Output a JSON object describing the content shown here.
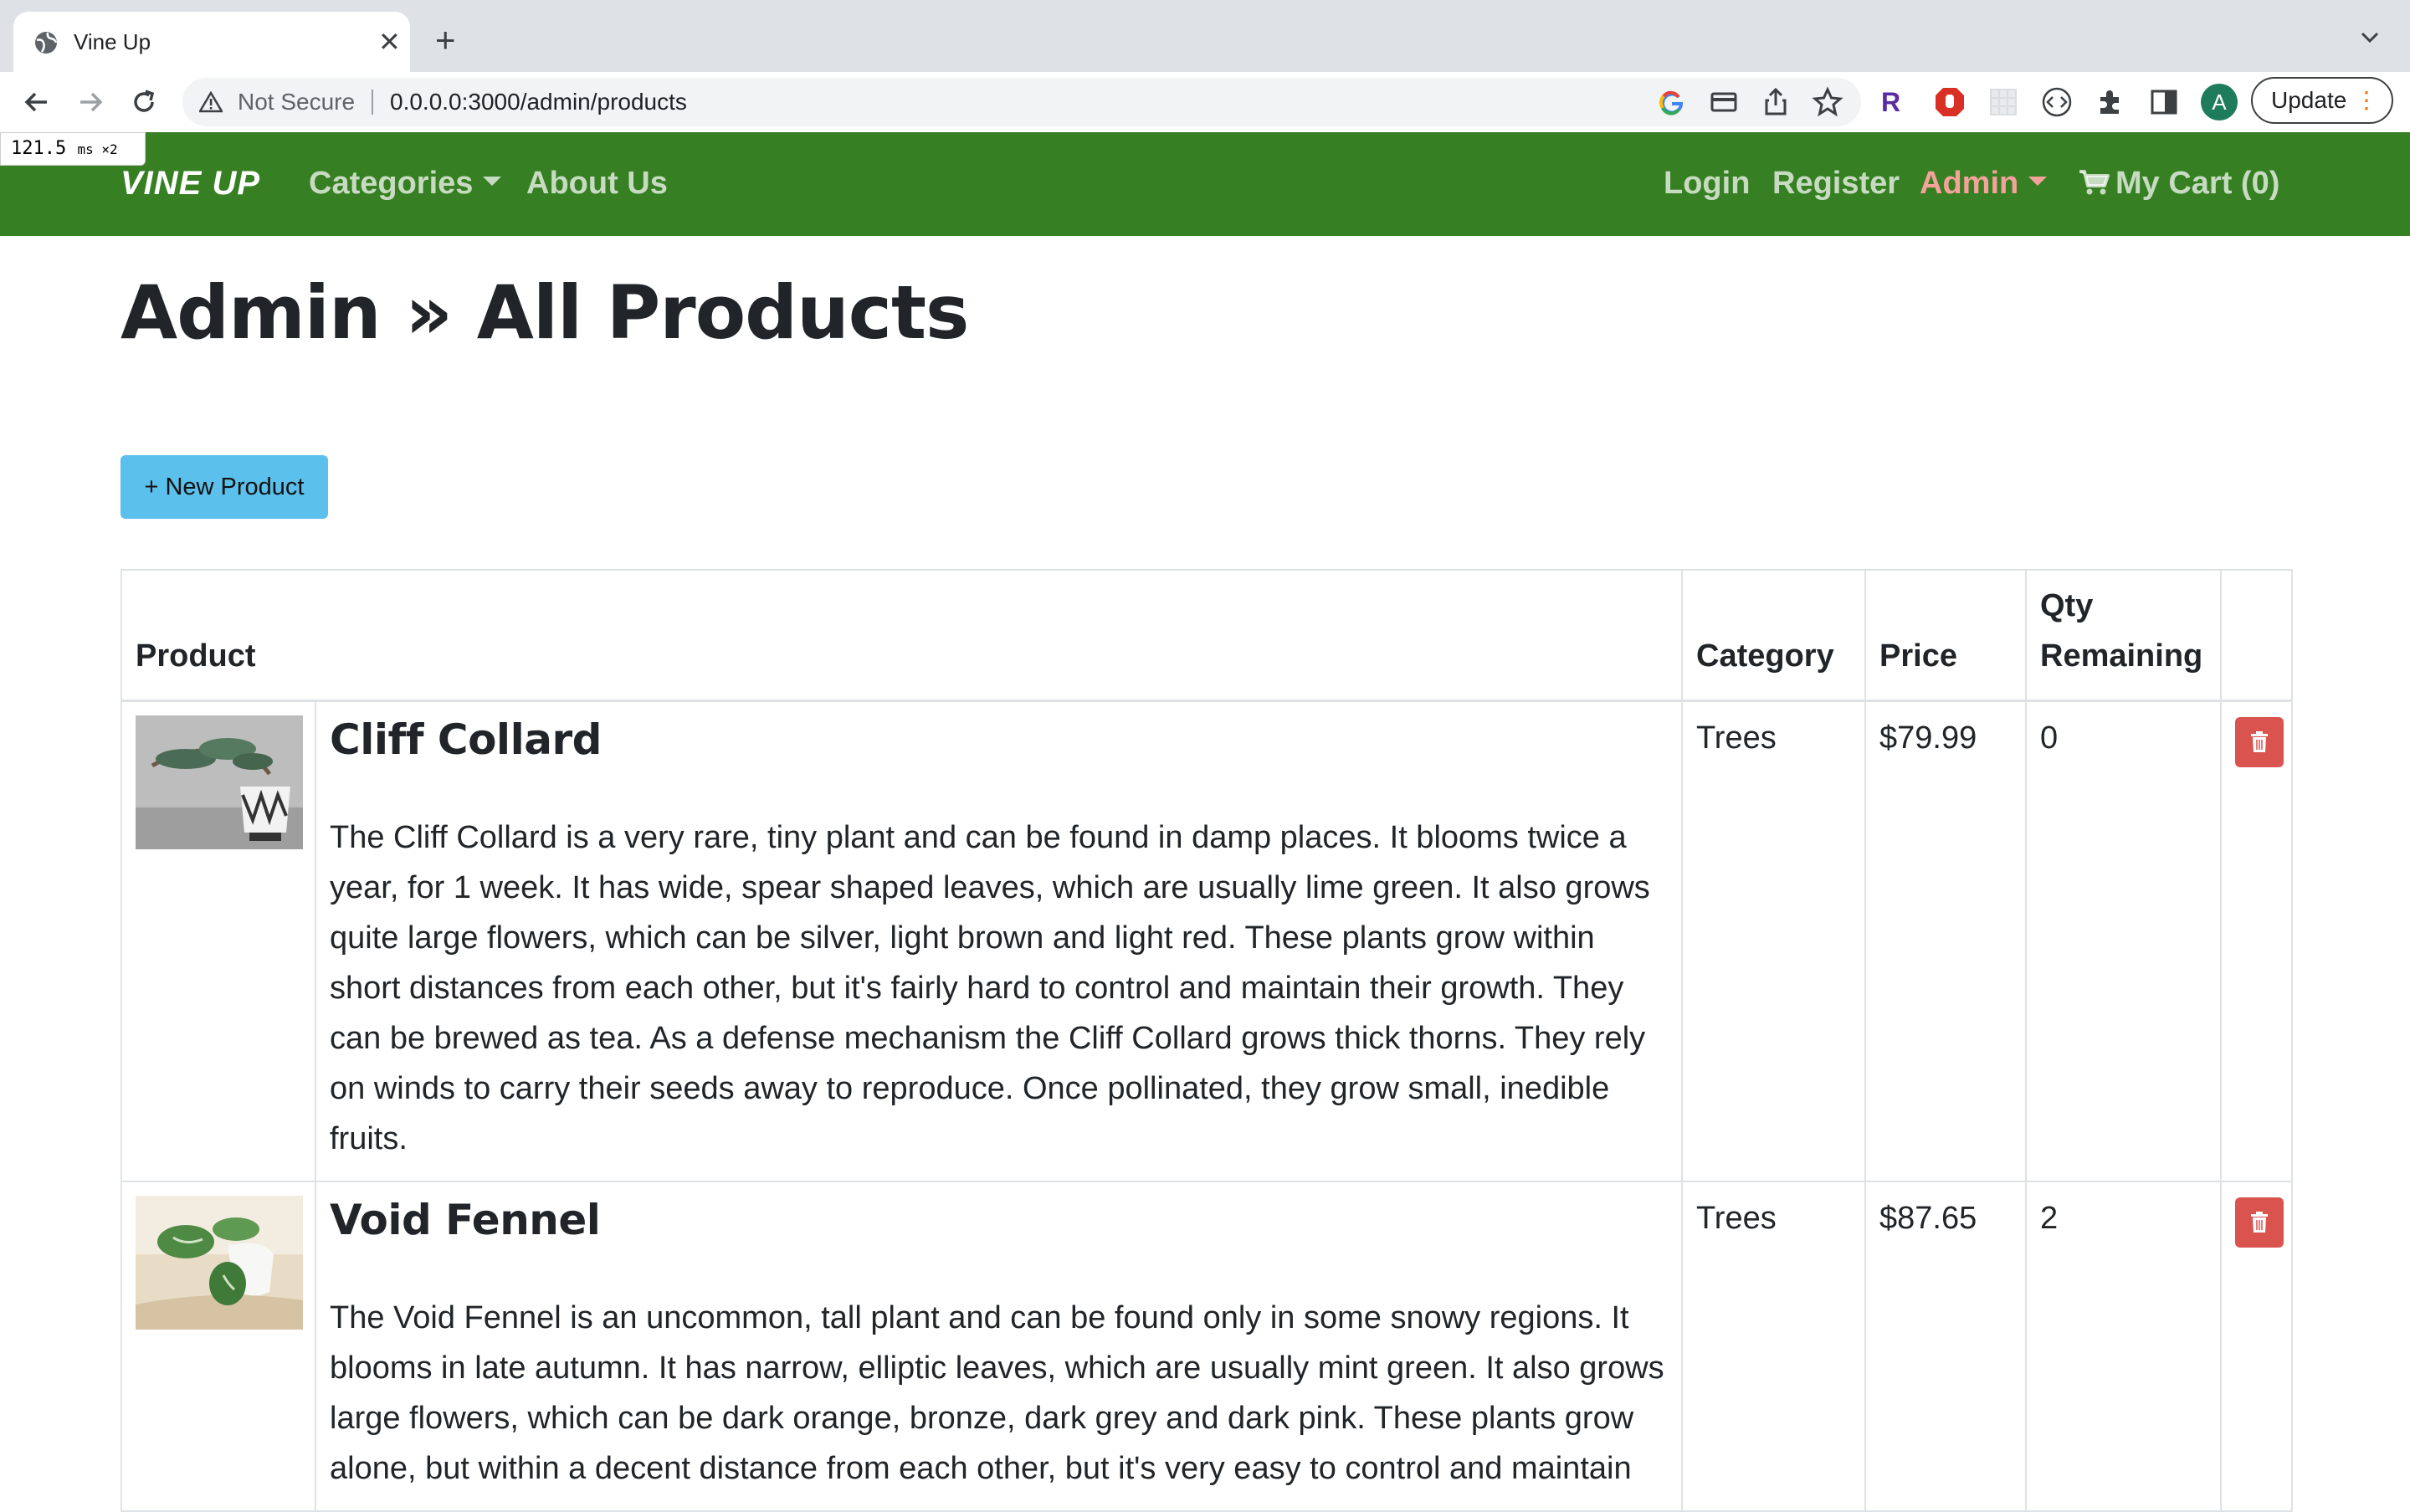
{
  "browser": {
    "tab_title": "Vine Up",
    "security_label": "Not Secure",
    "url": "0.0.0.0:3000/admin/products",
    "update_label": "Update",
    "avatar_letter": "A",
    "perf_value": "121.5",
    "perf_unit": "ms ×2"
  },
  "navbar": {
    "brand": "VINE UP",
    "categories": "Categories",
    "about": "About Us",
    "login": "Login",
    "register": "Register",
    "admin": "Admin",
    "cart": "My Cart (0)",
    "bg_color": "#367f23",
    "admin_color": "#f4a39b"
  },
  "page": {
    "title": "Admin » All Products",
    "new_product_label": "+ New Product",
    "button_color": "#5bc0eb"
  },
  "table": {
    "headers": {
      "product": "Product",
      "category": "Category",
      "price": "Price",
      "qty_line1": "Qty",
      "qty_line2": "Remaining"
    },
    "rows": [
      {
        "name": "Cliff Collard",
        "description": "The Cliff Collard is a very rare, tiny plant and can be found in damp places. It blooms twice a year, for 1 week. It has wide, spear shaped leaves, which are usually lime green. It also grows quite large flowers, which can be silver, light brown and light red. These plants grow within short distances from each other, but it's fairly hard to control and maintain their growth. They can be brewed as tea. As a defense mechanism the Cliff Collard grows thick thorns. They rely on winds to carry their seeds away to reproduce. Once pollinated, they grow small, inedible fruits.",
        "category": "Trees",
        "price": "$79.99",
        "qty": "0"
      },
      {
        "name": "Void Fennel",
        "description": "The Void Fennel is an uncommon, tall plant and can be found only in some snowy regions. It blooms in late autumn. It has narrow, elliptic leaves, which are usually mint green. It also grows large flowers, which can be dark orange, bronze, dark grey and dark pink. These plants grow alone, but within a decent distance from each other, but it's very easy to control and maintain",
        "category": "Trees",
        "price": "$87.65",
        "qty": "2"
      }
    ],
    "delete_color": "#d9534f"
  }
}
